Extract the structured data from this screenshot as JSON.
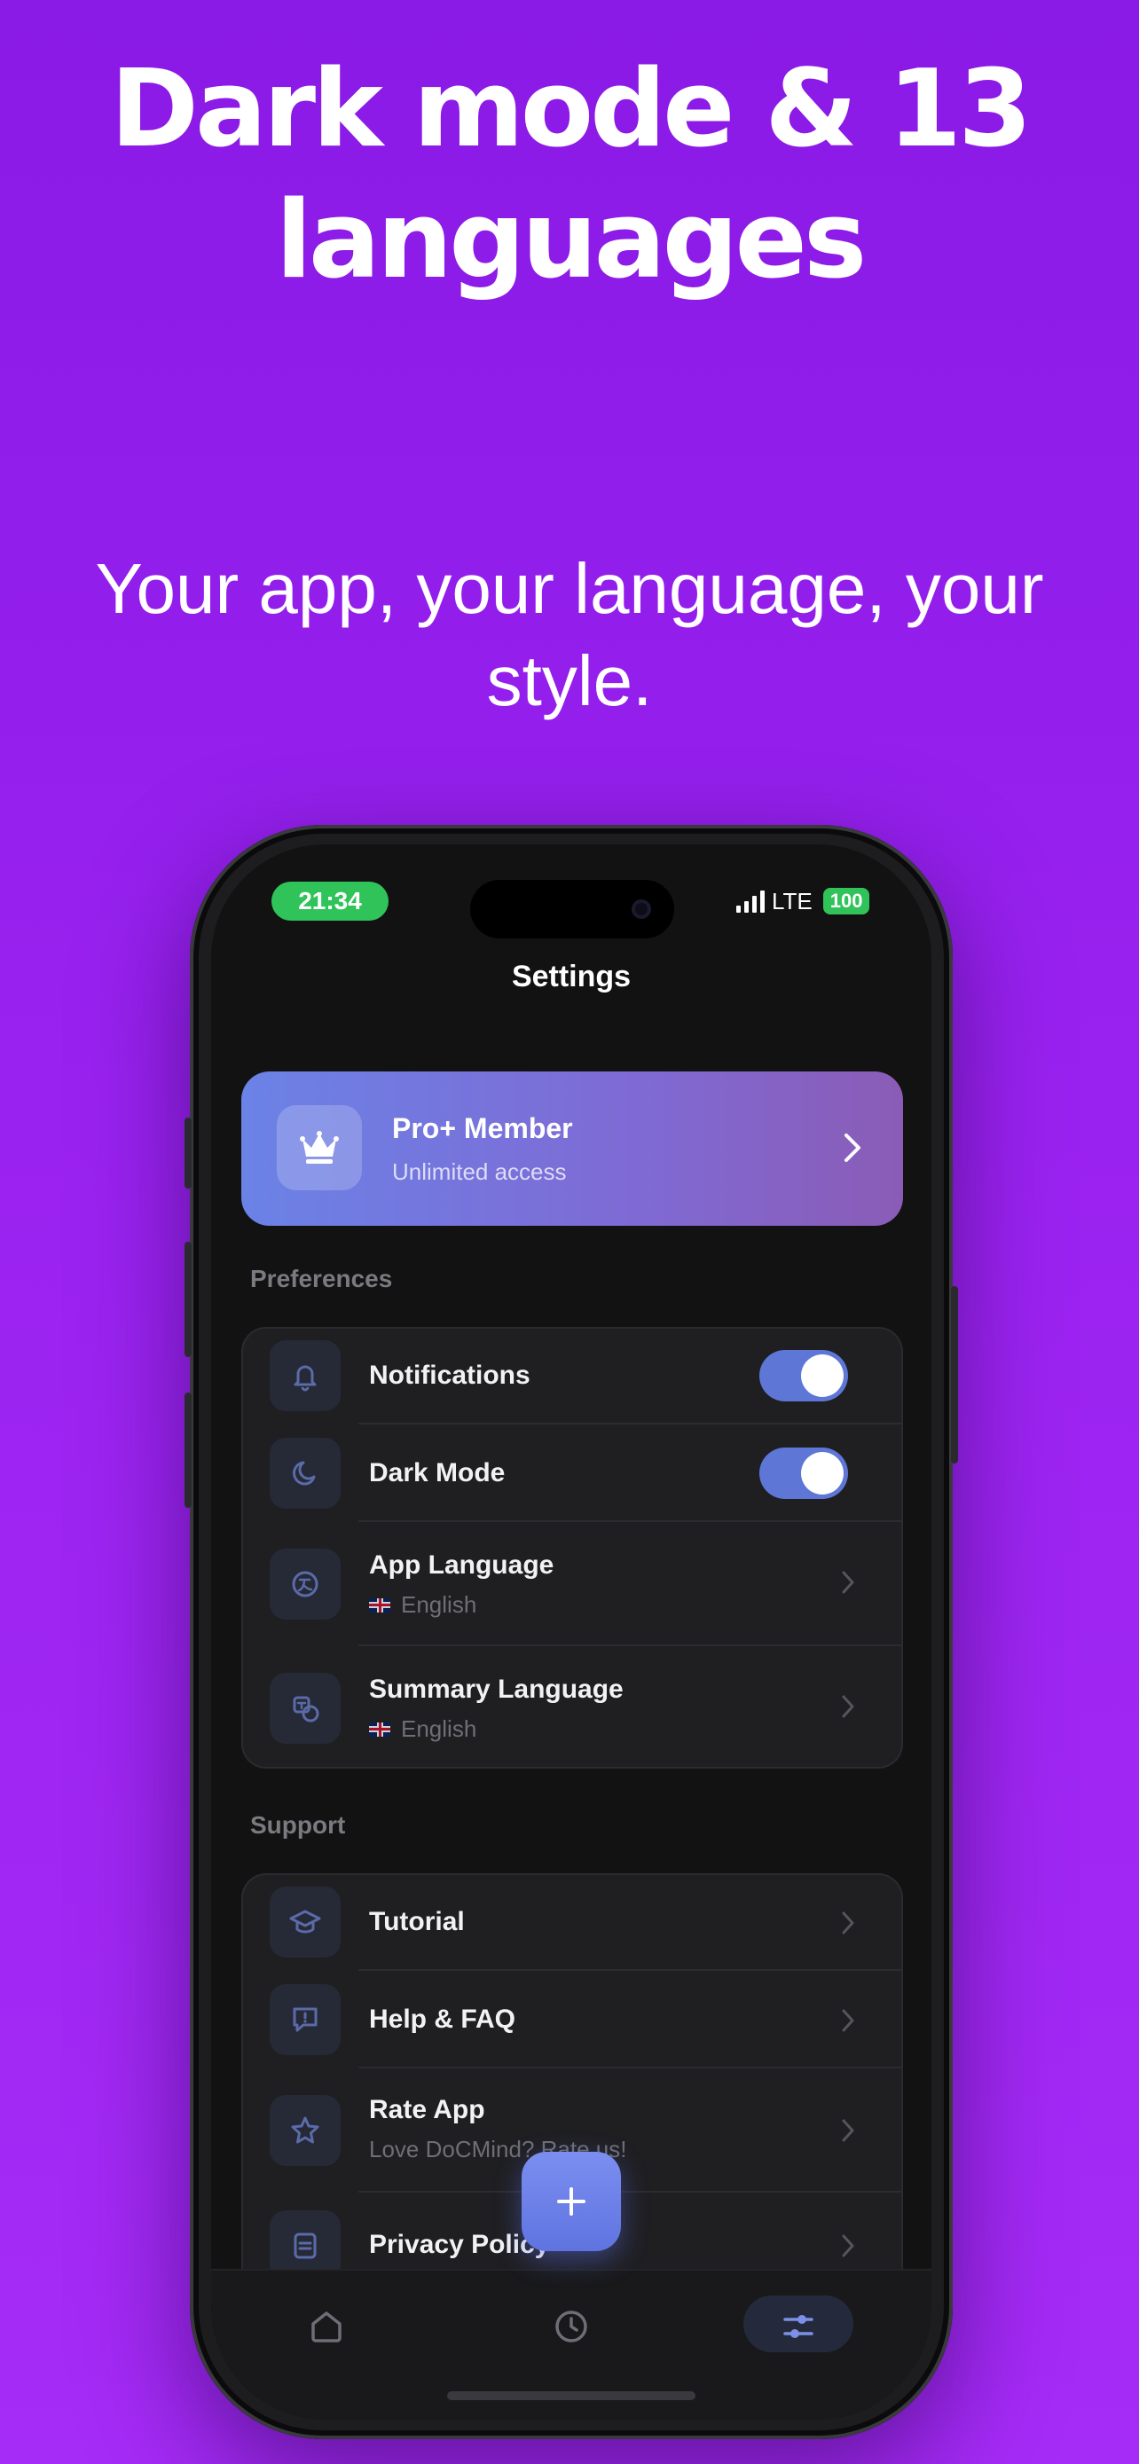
{
  "promo": {
    "headline": "Dark mode & 13 languages",
    "subline": "Your app, your language, your style."
  },
  "status_bar": {
    "time": "21:34",
    "network": "LTE",
    "battery": "100"
  },
  "screen": {
    "title": "Settings"
  },
  "pro_card": {
    "title": "Pro+ Member",
    "subtitle": "Unlimited access",
    "icon": "crown-icon"
  },
  "preferences": {
    "label": "Preferences",
    "items": [
      {
        "title": "Notifications",
        "icon": "bell-icon",
        "control": "toggle",
        "on": true
      },
      {
        "title": "Dark Mode",
        "icon": "moon-icon",
        "control": "toggle",
        "on": true
      },
      {
        "title": "App Language",
        "subtitle": "English",
        "icon": "translate-icon",
        "control": "chevron"
      },
      {
        "title": "Summary Language",
        "subtitle": "English",
        "icon": "language-doc-icon",
        "control": "chevron"
      }
    ]
  },
  "support": {
    "label": "Support",
    "items": [
      {
        "title": "Tutorial",
        "icon": "graduation-cap-icon"
      },
      {
        "title": "Help & FAQ",
        "icon": "help-chat-icon"
      },
      {
        "title": "Rate App",
        "subtitle": "Love DoCMind? Rate us!",
        "icon": "star-icon"
      },
      {
        "title": "Privacy Policy",
        "icon": "document-icon"
      }
    ]
  },
  "tab_bar": {
    "tabs": [
      {
        "icon": "home-icon",
        "active": false
      },
      {
        "icon": "clock-icon",
        "active": false
      },
      {
        "icon": "sliders-icon",
        "active": true
      }
    ],
    "fab_icon": "plus-icon"
  },
  "colors": {
    "background": "#9a22f0",
    "accent": "#5e77d6",
    "status_green": "#30c35a"
  }
}
